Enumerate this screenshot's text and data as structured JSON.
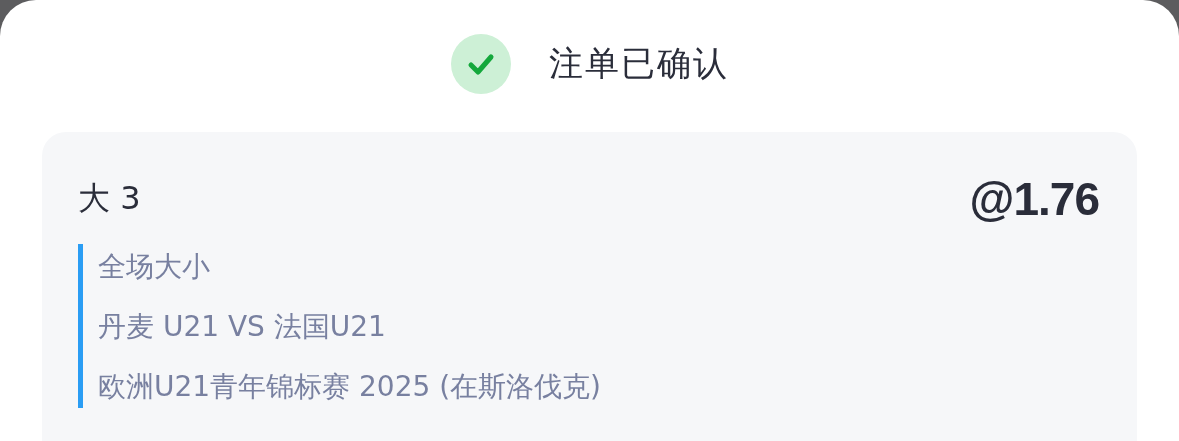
{
  "header": {
    "confirmed": true,
    "title": "注单已确认"
  },
  "bet": {
    "selection": "大 3",
    "odds": "@1.76",
    "details": [
      "全场大小",
      "丹麦 U21 VS 法国U21",
      "欧洲U21青年锦标赛 2025 (在斯洛伐克)"
    ]
  }
}
